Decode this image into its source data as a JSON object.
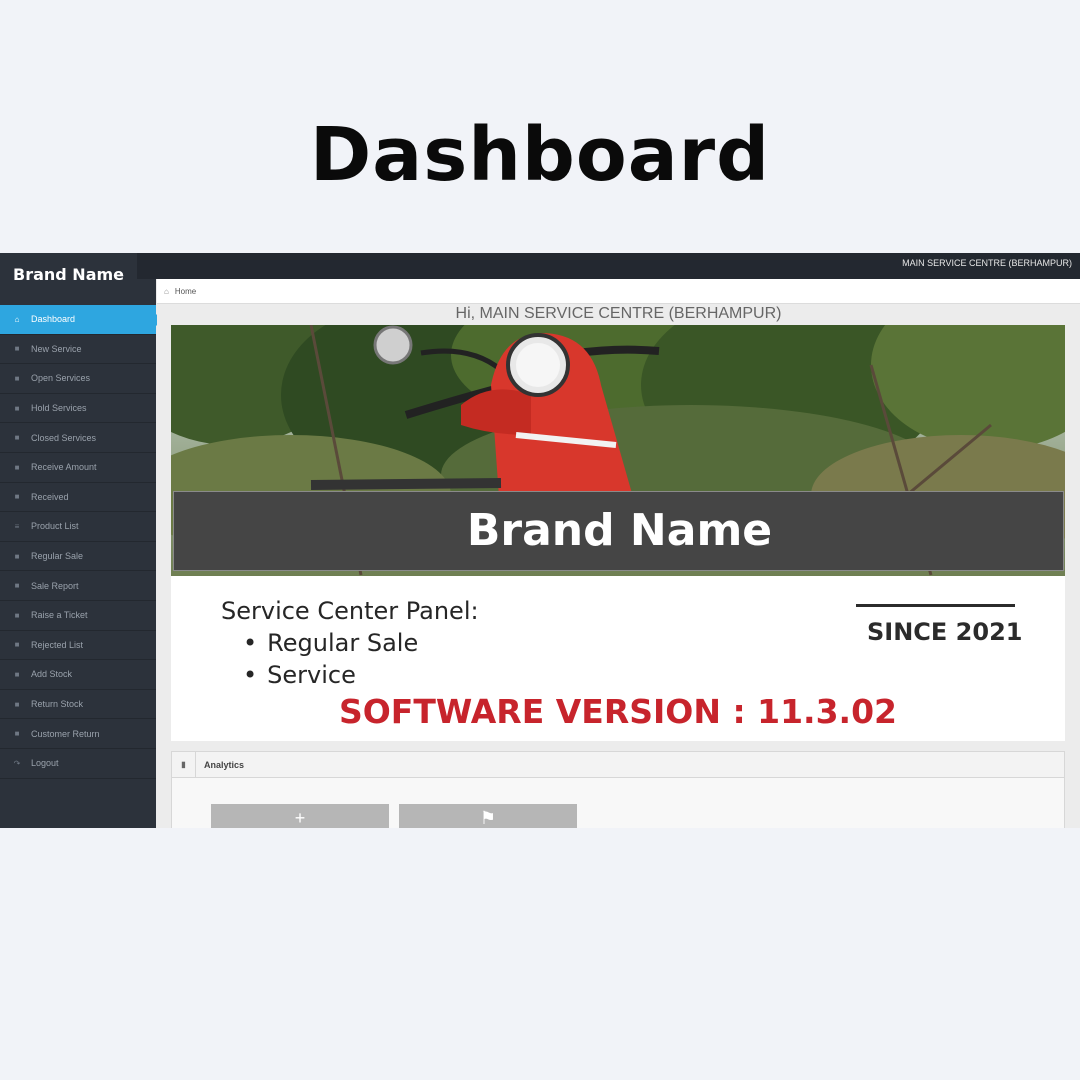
{
  "heading": "Dashboard",
  "brand": "Brand Name",
  "topbar": {
    "user": "MAIN SERVICE CENTRE (BERHAMPUR)"
  },
  "sidebar": {
    "items": [
      {
        "label": "Dashboard",
        "icon": "home-icon",
        "active": true
      },
      {
        "label": "New Service",
        "icon": "truck-icon"
      },
      {
        "label": "Open Services",
        "icon": "truck-icon"
      },
      {
        "label": "Hold Services",
        "icon": "truck-icon"
      },
      {
        "label": "Closed Services",
        "icon": "truck-icon"
      },
      {
        "label": "Receive Amount",
        "icon": "truck-icon"
      },
      {
        "label": "Received",
        "icon": "truck-icon"
      },
      {
        "label": "Product List",
        "icon": "list-icon"
      },
      {
        "label": "Regular Sale",
        "icon": "truck-icon"
      },
      {
        "label": "Sale Report",
        "icon": "truck-icon"
      },
      {
        "label": "Raise a Ticket",
        "icon": "truck-icon"
      },
      {
        "label": "Rejected List",
        "icon": "truck-icon"
      },
      {
        "label": "Add Stock",
        "icon": "truck-icon"
      },
      {
        "label": "Return Stock",
        "icon": "truck-icon"
      },
      {
        "label": "Customer Return",
        "icon": "truck-icon"
      },
      {
        "label": "Logout",
        "icon": "share-icon"
      }
    ]
  },
  "breadcrumb": {
    "home": "Home"
  },
  "greeting": "Hi, MAIN SERVICE CENTRE (BERHAMPUR)",
  "banner": {
    "brand": "Brand Name",
    "panel_title": "Service Center Panel:",
    "panel_items": [
      "Regular Sale",
      "Service"
    ],
    "since": "SINCE 2021",
    "version": "SOFTWARE VERSION : 11.3.02"
  },
  "analytics": {
    "title": "Analytics",
    "tiles": [
      {
        "icon": "plus-icon",
        "glyph": "+"
      },
      {
        "icon": "tag-icon",
        "glyph": "⚑"
      }
    ]
  },
  "colors": {
    "active": "#2ea6e0",
    "sidebar": "#2c323b",
    "version": "#c7242c"
  }
}
